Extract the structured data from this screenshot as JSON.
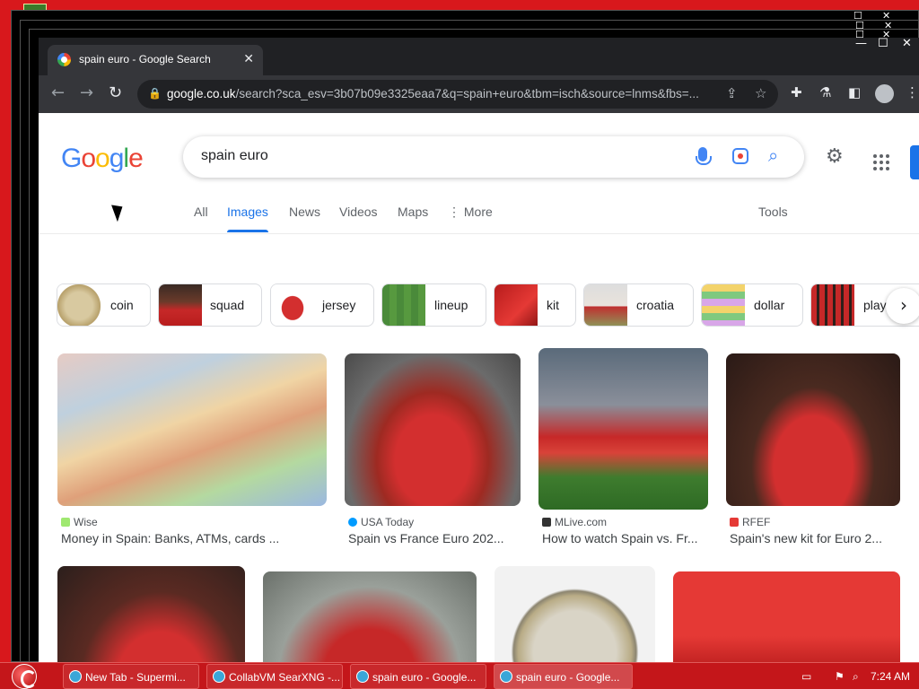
{
  "tab": {
    "title": "spain euro - Google Search",
    "close": "✕"
  },
  "window_controls": {
    "minimize": "—",
    "maximize": "☐",
    "close": "✕"
  },
  "address": {
    "host": "google.co.uk",
    "path": "/search?sca_esv=3b07b09e3325eaa7&q=spain+euro&tbm=isch&source=lnms&fbs=..."
  },
  "search": {
    "query": "spain euro"
  },
  "logo": [
    "G",
    "o",
    "o",
    "g",
    "l",
    "e"
  ],
  "nav_tabs": [
    "All",
    "Images",
    "News",
    "Videos",
    "Maps",
    "⋮ More"
  ],
  "tools": "Tools",
  "chips": [
    "coin",
    "squad",
    "jersey",
    "lineup",
    "kit",
    "croatia",
    "dollar",
    "play"
  ],
  "results_row1": [
    {
      "source": "Wise",
      "caption": "Money in Spain: Banks, ATMs, cards ..."
    },
    {
      "source": "USA Today",
      "caption": "Spain vs France Euro 202..."
    },
    {
      "source": "MLive.com",
      "caption": "How to watch Spain vs. Fr..."
    },
    {
      "source": "RFEF",
      "caption": "Spain's new kit for Euro 2..."
    }
  ],
  "taskbar": {
    "tasks": [
      "New Tab - Supermi...",
      "CollabVM SearXNG -...",
      "spain euro - Google...",
      "spain euro - Google..."
    ],
    "clock": "7:24 AM"
  },
  "colors": {
    "google_blue": "#4285f4",
    "google_red": "#ea4335",
    "google_yellow": "#fbbc05",
    "google_green": "#34a853",
    "taskbar": "#c4161a"
  }
}
